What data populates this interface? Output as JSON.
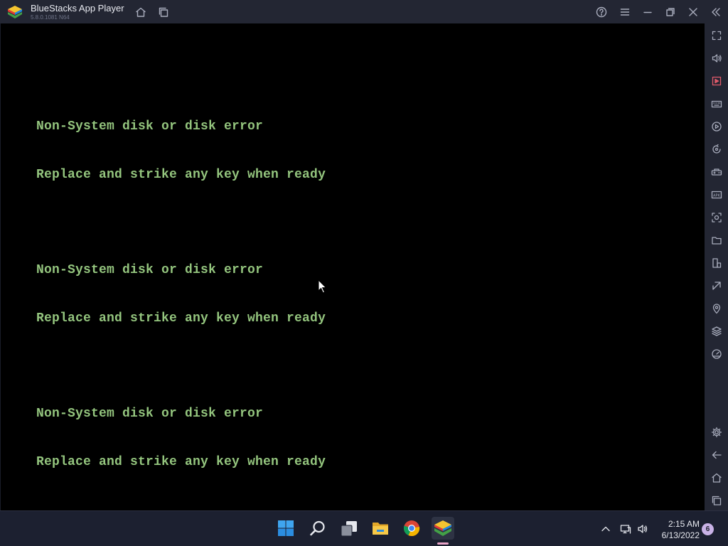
{
  "titlebar": {
    "title": "BlueStacks App Player",
    "version": "5.8.0.1081 N64",
    "icons": [
      "bluestacks-logo",
      "home-icon",
      "multi-instance-icon",
      "help-icon",
      "menu-icon",
      "minimize-icon",
      "restore-icon",
      "close-icon",
      "collapse-sidebar-icon"
    ]
  },
  "screen": {
    "lines": [
      "Non-System disk or disk error",
      "Replace and strike any key when ready",
      "Non-System disk or disk error",
      "Replace and strike any key when ready",
      "Non-System disk or disk error",
      "Replace and strike any key when ready"
    ],
    "text_color": "#94c57e"
  },
  "sidebar": {
    "icons": [
      "fullscreen-icon",
      "volume-icon",
      "media-manager-icon",
      "keyboard-controls-icon",
      "macro-record-icon",
      "rotate-sync-icon",
      "gamepad-icon",
      "install-apk-icon",
      "screenshot-icon",
      "folder-icon",
      "multi-instance-manager-icon",
      "eco-mode-icon",
      "location-icon",
      "layers-icon",
      "performance-icon",
      "settings-icon",
      "back-icon",
      "android-home-icon",
      "recent-apps-icon"
    ]
  },
  "taskbar": {
    "apps": [
      "windows-start-icon",
      "search-icon",
      "task-view-icon",
      "file-explorer-icon",
      "chrome-icon",
      "bluestacks-taskbar-icon"
    ],
    "tray": [
      "chevron-up-icon",
      "network-icon",
      "volume-icon"
    ],
    "time": "2:15 AM",
    "date": "6/13/2022",
    "notification_count": "6"
  },
  "colors": {
    "titlebar_bg": "#232633",
    "screen_bg": "#000000",
    "taskbar_bg": "#1c2030",
    "accent": "#e8a3c6"
  }
}
